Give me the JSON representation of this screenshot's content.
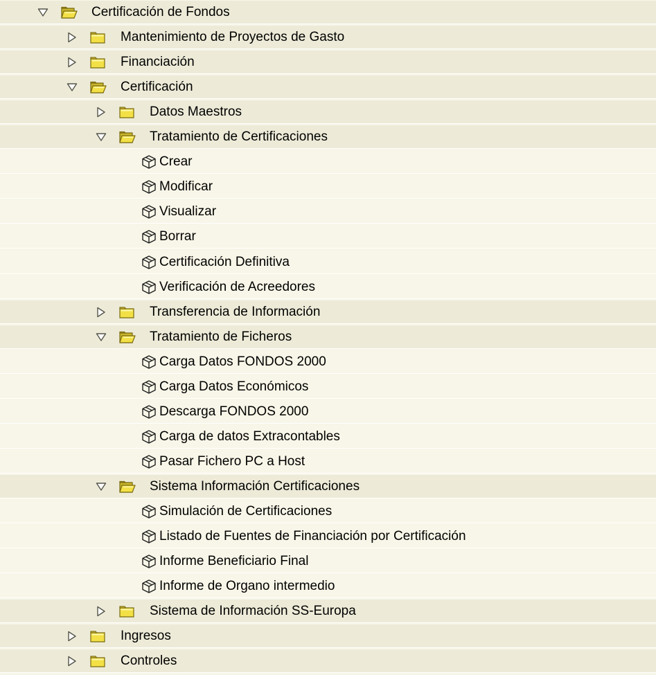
{
  "tree": [
    {
      "label": "Certificación de Fondos",
      "level": 0,
      "kind": "folder",
      "expanded": true
    },
    {
      "label": "Mantenimiento de Proyectos de Gasto",
      "level": 1,
      "kind": "folder",
      "expanded": false
    },
    {
      "label": "Financiación",
      "level": 1,
      "kind": "folder",
      "expanded": false
    },
    {
      "label": "Certificación",
      "level": 1,
      "kind": "folder",
      "expanded": true
    },
    {
      "label": "Datos Maestros",
      "level": 2,
      "kind": "folder",
      "expanded": false
    },
    {
      "label": "Tratamiento de Certificaciones",
      "level": 2,
      "kind": "folder",
      "expanded": true
    },
    {
      "label": "Crear",
      "level": 3,
      "kind": "transaction"
    },
    {
      "label": "Modificar",
      "level": 3,
      "kind": "transaction"
    },
    {
      "label": "Visualizar",
      "level": 3,
      "kind": "transaction"
    },
    {
      "label": "Borrar",
      "level": 3,
      "kind": "transaction"
    },
    {
      "label": "Certificación Definitiva",
      "level": 3,
      "kind": "transaction"
    },
    {
      "label": "Verificación de Acreedores",
      "level": 3,
      "kind": "transaction"
    },
    {
      "label": "Transferencia de Información",
      "level": 2,
      "kind": "folder",
      "expanded": false
    },
    {
      "label": "Tratamiento de Ficheros",
      "level": 2,
      "kind": "folder",
      "expanded": true
    },
    {
      "label": "Carga Datos FONDOS 2000",
      "level": 3,
      "kind": "transaction"
    },
    {
      "label": "Carga Datos Económicos",
      "level": 3,
      "kind": "transaction"
    },
    {
      "label": "Descarga FONDOS 2000",
      "level": 3,
      "kind": "transaction"
    },
    {
      "label": "Carga de datos Extracontables",
      "level": 3,
      "kind": "transaction"
    },
    {
      "label": "Pasar Fichero PC a Host",
      "level": 3,
      "kind": "transaction"
    },
    {
      "label": "Sistema Información Certificaciones",
      "level": 2,
      "kind": "folder",
      "expanded": true
    },
    {
      "label": "Simulación de Certificaciones",
      "level": 3,
      "kind": "transaction"
    },
    {
      "label": "Listado de Fuentes de Financiación por Certificación",
      "level": 3,
      "kind": "transaction"
    },
    {
      "label": "Informe Beneficiario Final",
      "level": 3,
      "kind": "transaction"
    },
    {
      "label": "Informe de Organo intermedio",
      "level": 3,
      "kind": "transaction"
    },
    {
      "label": "Sistema de Información SS-Europa",
      "level": 2,
      "kind": "folder",
      "expanded": false
    },
    {
      "label": "Ingresos",
      "level": 1,
      "kind": "folder",
      "expanded": false
    },
    {
      "label": "Controles",
      "level": 1,
      "kind": "folder",
      "expanded": false
    }
  ],
  "icons": {
    "expanded": "triangle-down-icon",
    "collapsed": "triangle-right-icon",
    "folder_closed": "folder-icon",
    "folder_open": "folder-open-icon",
    "transaction": "transaction-cube-icon"
  },
  "colors": {
    "background": "#f7f5e7",
    "folder_row": "#edebd8",
    "leaf_row": "#f8f6e8",
    "folder_fill": "#f2e046",
    "folder_dark": "#7a6a10",
    "text": "#000000"
  }
}
